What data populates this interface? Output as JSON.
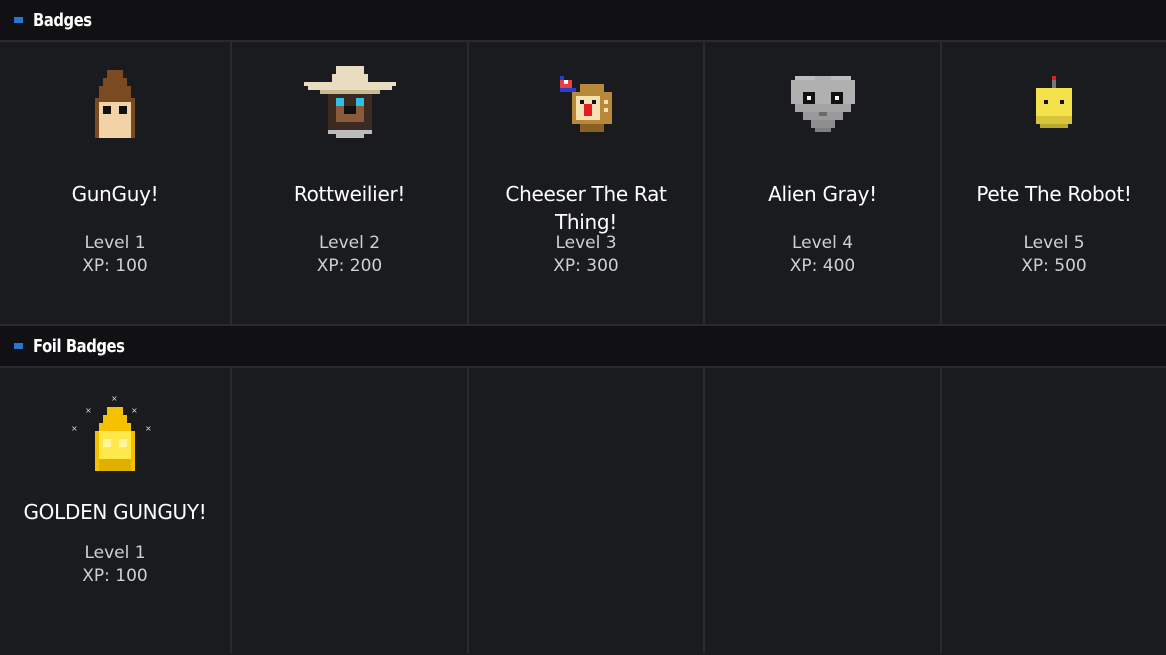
{
  "sections": {
    "badges": {
      "title": "Badges",
      "items": [
        {
          "name": "GunGuy!",
          "level": "Level 1",
          "xp": "XP: 100",
          "icon": "gunguy-icon"
        },
        {
          "name": "Rottweilier!",
          "level": "Level 2",
          "xp": "XP: 200",
          "icon": "rottweiler-icon"
        },
        {
          "name": "Cheeser The Rat Thing!",
          "level": "Level 3",
          "xp": "XP: 300",
          "icon": "cheeser-rat-icon"
        },
        {
          "name": "Alien Gray!",
          "level": "Level 4",
          "xp": "XP: 400",
          "icon": "alien-gray-icon"
        },
        {
          "name": "Pete The Robot!",
          "level": "Level 5",
          "xp": "XP: 500",
          "icon": "robot-icon"
        }
      ]
    },
    "foil": {
      "title": "Foil Badges",
      "items": [
        {
          "name": "GOLDEN GUNGUY!",
          "level": "Level 1",
          "xp": "XP: 100",
          "icon": "golden-gunguy-icon"
        }
      ]
    }
  },
  "colors": {
    "accent": "#2b73d6",
    "background": "#1a1b1f",
    "header": "#111114"
  }
}
